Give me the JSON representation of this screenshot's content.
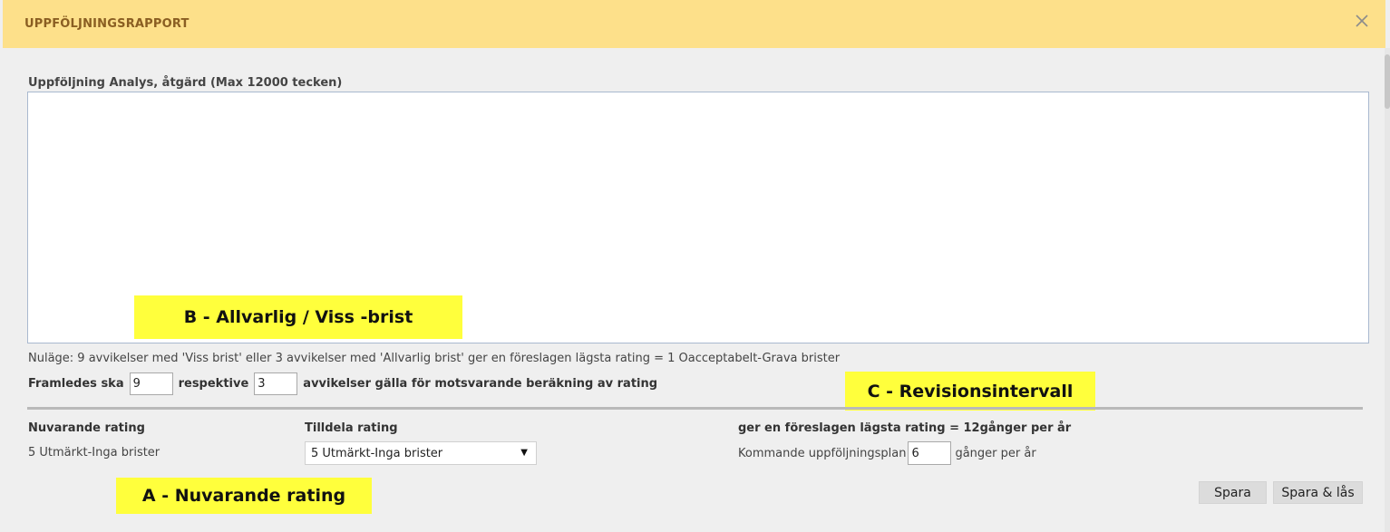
{
  "header": {
    "title": "UPPFÖLJNINGSRAPPORT",
    "close_icon": "close-icon"
  },
  "analysis": {
    "label": "Uppföljning Analys, åtgärd (Max 12000 tecken)",
    "value": ""
  },
  "callouts": {
    "b": "B - Allvarlig / Viss -brist",
    "c": "C - Revisionsintervall",
    "a": "A - Nuvarande rating"
  },
  "status": {
    "text": "Nuläge: 9 avvikelser med 'Viss brist' eller 3 avvikelser med 'Allvarlig brist' ger en föreslagen lägsta rating = 1 Oacceptabelt-Grava brister"
  },
  "framledes": {
    "prefix": "Framledes ska",
    "viss_value": "9",
    "middle": "respektive",
    "allvarlig_value": "3",
    "suffix": "avvikelser gälla för motsvarande beräkning av rating"
  },
  "rating": {
    "current_heading": "Nuvarande rating",
    "current_value": "5 Utmärkt-Inga brister",
    "assign_heading": "Tilldela rating",
    "assign_selected": "5 Utmärkt-Inga brister",
    "dropdown_icon": "chevron-down-icon"
  },
  "interval": {
    "heading": "ger en föreslagen lägsta rating = 12gånger per år",
    "plan_prefix": "Kommande uppföljningsplan",
    "plan_value": "6",
    "plan_suffix": "gånger per år"
  },
  "buttons": {
    "save": "Spara",
    "save_lock": "Spara & lås"
  },
  "colors": {
    "header_bg": "#fde08a",
    "header_title": "#8a5e22",
    "callout_bg": "#ffff3c",
    "dialog_bg": "#efefef"
  }
}
